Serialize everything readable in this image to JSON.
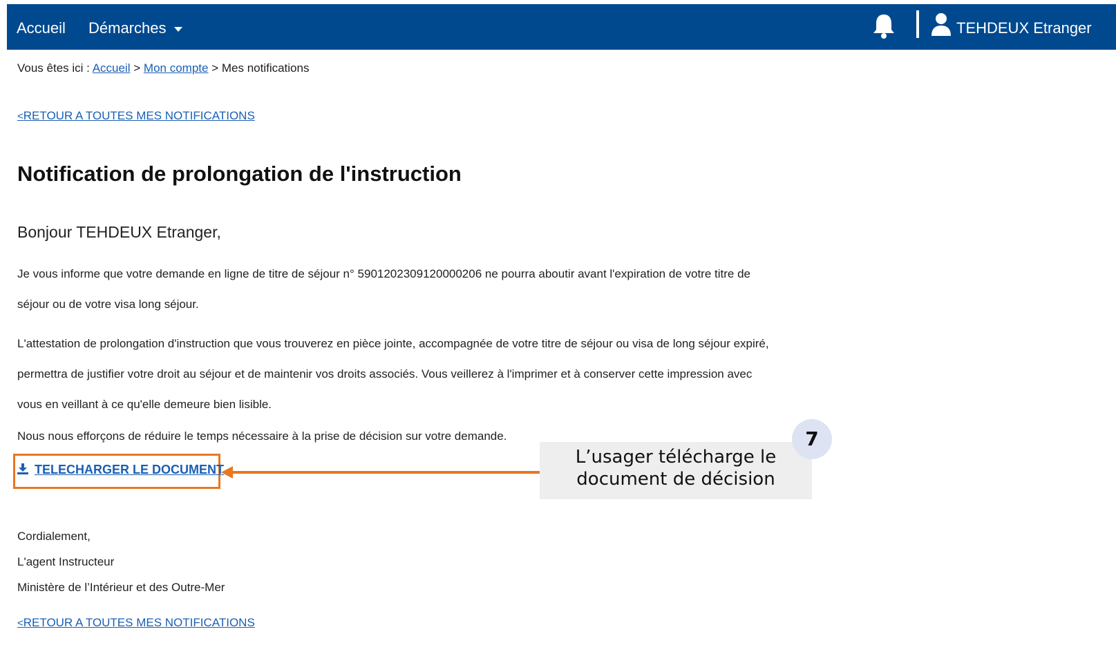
{
  "nav": {
    "home": "Accueil",
    "demarches": "Démarches",
    "user_name": "TEHDEUX Etranger"
  },
  "breadcrumb": {
    "prefix": "Vous êtes ici :",
    "items": [
      "Accueil",
      "Mon compte",
      "Mes notifications"
    ],
    "separator": ">"
  },
  "back_link": {
    "chevron": "<",
    "label": "RETOUR A TOUTES MES NOTIFICATIONS"
  },
  "notification": {
    "title": "Notification de prolongation de l'instruction",
    "greeting": "Bonjour TEHDEUX Etranger,",
    "paragraph1": "Je vous informe que votre demande en ligne de titre de séjour n° 5901202309120000206 ne pourra aboutir avant l'expiration de votre titre de séjour ou de votre visa long séjour.",
    "paragraph2": "L'attestation de prolongation d'instruction que vous trouverez en pièce jointe, accompagnée de votre titre de séjour ou visa de long séjour expiré, permettra de justifier votre droit au séjour et de maintenir vos droits associés. Vous veillerez à l'imprimer et à conserver cette impression avec vous en veillant à ce qu'elle demeure bien lisible.",
    "paragraph3": "Nous nous efforçons de réduire le temps nécessaire à la prise de décision sur votre demande.",
    "download_label": "TELECHARGER LE DOCUMENT",
    "closing": [
      "Cordialement,",
      "L'agent Instructeur",
      "Ministère de l’Intérieur et des Outre-Mer"
    ]
  },
  "annotation": {
    "step": "7",
    "line1": "L’usager télécharge le",
    "line2": "document de décision",
    "color": "#e87722"
  },
  "colors": {
    "header_bg": "#00498f",
    "link": "#1a5fb4",
    "badge_bg": "#dde3f2",
    "callout_bg": "#eeeeee"
  }
}
